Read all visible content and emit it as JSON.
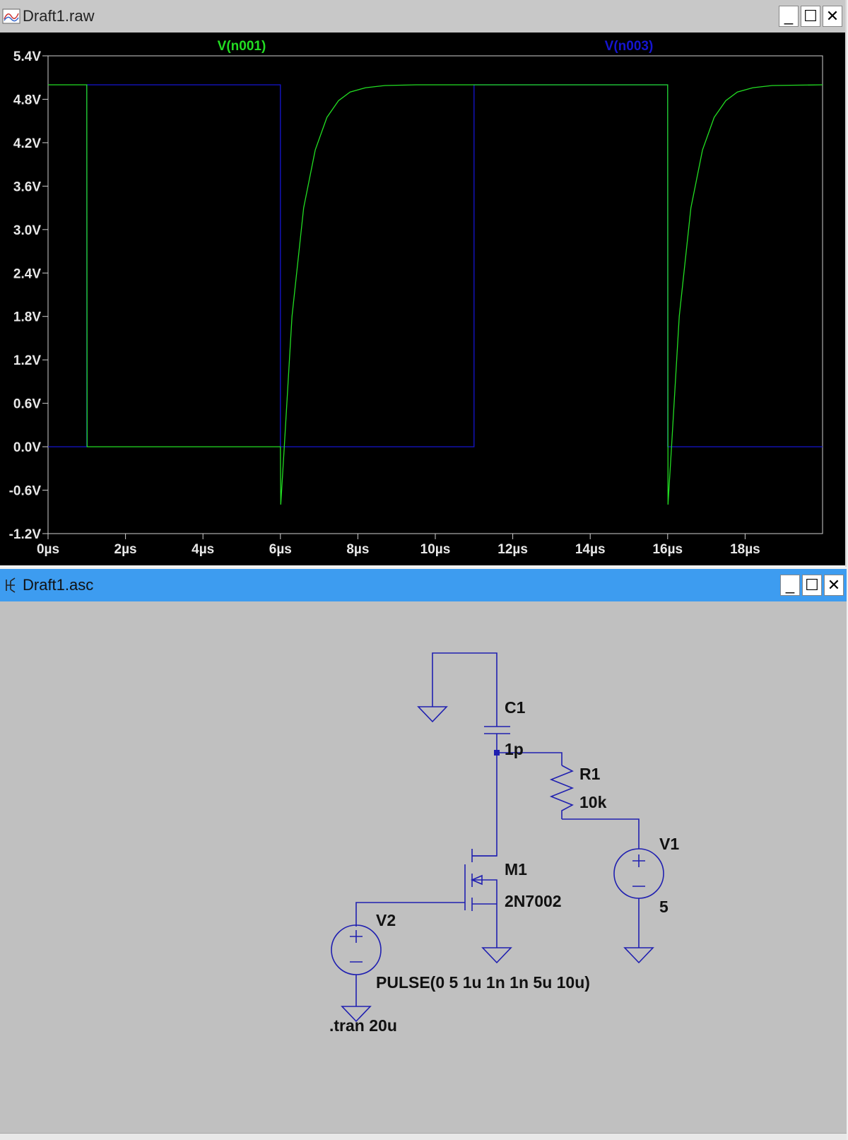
{
  "raw_window": {
    "title": "Draft1.raw",
    "controls": {
      "minimize": "_",
      "maximize": "☐",
      "close": "✕"
    }
  },
  "asc_window": {
    "title": "Draft1.asc",
    "controls": {
      "minimize": "_",
      "maximize": "☐",
      "close": "✕"
    }
  },
  "chart_data": {
    "type": "line",
    "xlabel": "",
    "ylabel": "",
    "xlim": [
      0,
      20
    ],
    "ylim": [
      -1.2,
      5.4
    ],
    "x_ticks": [
      "0µs",
      "2µs",
      "4µs",
      "6µs",
      "8µs",
      "10µs",
      "12µs",
      "14µs",
      "16µs",
      "18µs"
    ],
    "y_ticks": [
      "5.4V",
      "4.8V",
      "4.2V",
      "3.6V",
      "3.0V",
      "2.4V",
      "1.8V",
      "1.2V",
      "0.6V",
      "0.0V",
      "-0.6V",
      "-1.2V"
    ],
    "grid": false,
    "background": "#000000",
    "series": [
      {
        "name": "V(n001)",
        "color": "#22dd22",
        "x": [
          0,
          1,
          1.01,
          6,
          6.01,
          6.1,
          6.3,
          6.6,
          6.9,
          7.2,
          7.5,
          7.8,
          8.2,
          8.7,
          9.5,
          11,
          16,
          16.01,
          16.1,
          16.3,
          16.6,
          16.9,
          17.2,
          17.5,
          17.8,
          18.2,
          18.7,
          20
        ],
        "y": [
          5.0,
          5.0,
          0.0,
          0.0,
          -0.8,
          0.0,
          1.8,
          3.3,
          4.1,
          4.55,
          4.78,
          4.9,
          4.96,
          4.99,
          5.0,
          5.0,
          5.0,
          -0.8,
          0.0,
          1.8,
          3.3,
          4.1,
          4.55,
          4.78,
          4.9,
          4.96,
          4.99,
          5.0
        ]
      },
      {
        "name": "V(n003)",
        "color": "#1515d0",
        "x": [
          0,
          1,
          1,
          6,
          6,
          11,
          11,
          16,
          16,
          20
        ],
        "y": [
          0,
          0,
          5,
          5,
          0,
          0,
          5,
          5,
          0,
          0
        ]
      }
    ]
  },
  "schematic": {
    "color": "#2020b0",
    "components": {
      "c1": {
        "name": "C1",
        "value": "1p"
      },
      "r1": {
        "name": "R1",
        "value": "10k"
      },
      "m1": {
        "name": "M1",
        "value": "2N7002"
      },
      "v1": {
        "name": "V1",
        "value": "5"
      },
      "v2": {
        "name": "V2",
        "value": "PULSE(0 5 1u 1n 1n 5u 10u)"
      }
    },
    "directive": ".tran 20u"
  }
}
